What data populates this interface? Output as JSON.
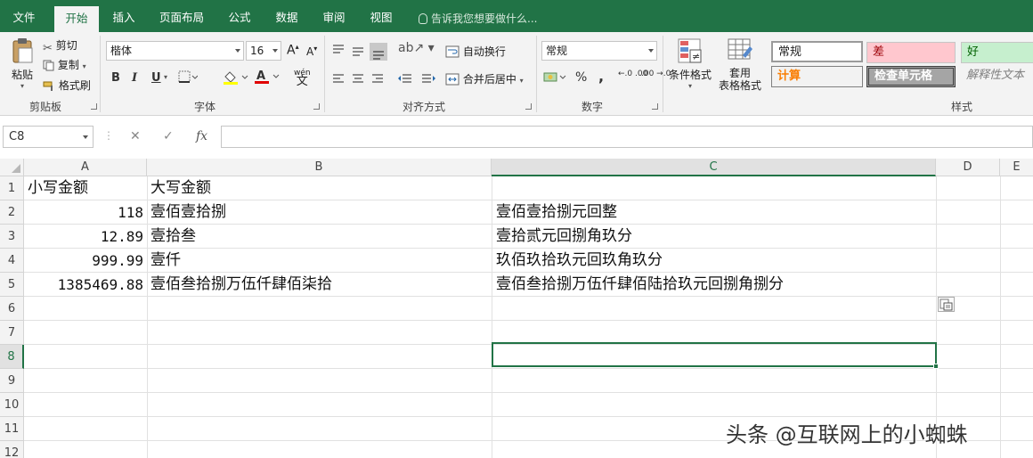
{
  "tabs": [
    "文件",
    "开始",
    "插入",
    "页面布局",
    "公式",
    "数据",
    "审阅",
    "视图"
  ],
  "active_tab": "开始",
  "tell_me": "告诉我您想要做什么...",
  "clipboard": {
    "paste": "粘贴",
    "cut": "剪切",
    "copy": "复制",
    "format_painter": "格式刷",
    "label": "剪贴板"
  },
  "font": {
    "family": "楷体",
    "size": "16",
    "bold": "B",
    "italic": "I",
    "underline": "U",
    "grow": "A",
    "shrink": "A",
    "wen": "wén",
    "label": "字体"
  },
  "alignment": {
    "wrap": "自动换行",
    "merge": "合并后居中",
    "label": "对齐方式"
  },
  "number": {
    "format": "常规",
    "percent": "%",
    "comma": ",",
    "inc_decimal": "←.0 .00",
    "dec_decimal": ".00 →.0",
    "label": "数字"
  },
  "styles": {
    "conditional": "条件格式",
    "table_line1": "套用",
    "table_line2": "表格格式",
    "normal": "常规",
    "bad": "差",
    "good": "好",
    "calc": "计算",
    "check": "检查单元格",
    "explain": "解释性文本",
    "label": "样式",
    "colors": {
      "bad_bg": "#ffc7ce",
      "bad_fg": "#9c0006",
      "good_bg": "#c6efce",
      "good_fg": "#006100",
      "calc_fg": "#fa7d00",
      "check_bg": "#a5a5a5"
    }
  },
  "formula_bar": {
    "name_box": "C8",
    "cancel": "✕",
    "enter": "✓",
    "fx": "fx",
    "value": ""
  },
  "columns": [
    "A",
    "B",
    "C",
    "D",
    "E"
  ],
  "rows": [
    "1",
    "2",
    "3",
    "4",
    "5",
    "6",
    "7",
    "8",
    "9",
    "10",
    "11",
    "12"
  ],
  "cells": {
    "A1": "小写金额",
    "B1": "大写金额",
    "A2": "118",
    "B2": "壹佰壹拾捌",
    "C2": "壹佰壹拾捌元回整",
    "A3": "12.89",
    "B3": "壹拾叁",
    "C3": "壹拾贰元回捌角玖分",
    "A4": "999.99",
    "B4": "壹仟",
    "C4": "玖佰玖拾玖元回玖角玖分",
    "A5": "1385469.88",
    "B5": "壹佰叁拾捌万伍仟肆佰柒拾",
    "C5": "壹佰叁拾捌万伍仟肆佰陆拾玖元回捌角捌分"
  },
  "selected_cell": "C8",
  "watermark": "头条 @互联网上的小蜘蛛",
  "theme": {
    "accent": "#217346"
  }
}
